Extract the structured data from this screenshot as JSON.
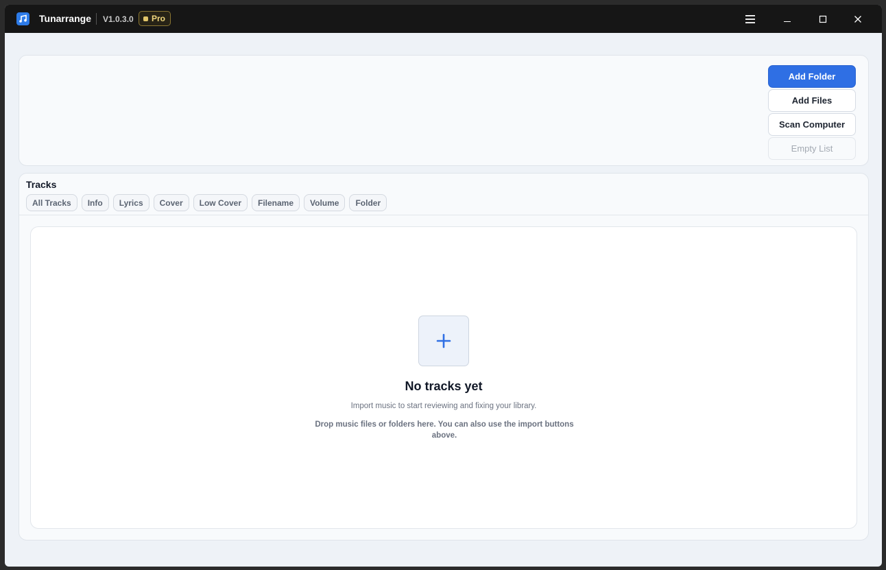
{
  "titlebar": {
    "app_name": "Tunarrange",
    "version": "V1.0.3.0",
    "badge": "Pro",
    "icons": [
      "music-app-icon",
      "hamburger-menu-icon",
      "minimize-icon",
      "maximize-icon",
      "close-icon"
    ]
  },
  "import": {
    "add_folder": "Add Folder",
    "add_files": "Add Files",
    "scan_computer": "Scan Computer",
    "empty_list": "Empty List"
  },
  "tracks": {
    "title": "Tracks",
    "filters": [
      "All Tracks",
      "Info",
      "Lyrics",
      "Cover",
      "Low Cover",
      "Filename",
      "Volume",
      "Folder"
    ]
  },
  "empty_state": {
    "title": "No tracks yet",
    "subtitle": "Import music to start reviewing and fixing your library.",
    "hint": "Drop music files or folders here. You can also use the import buttons above.",
    "icon": "plus-icon"
  },
  "colors": {
    "accent": "#2f6fe4",
    "badge": "#e2c66a"
  }
}
